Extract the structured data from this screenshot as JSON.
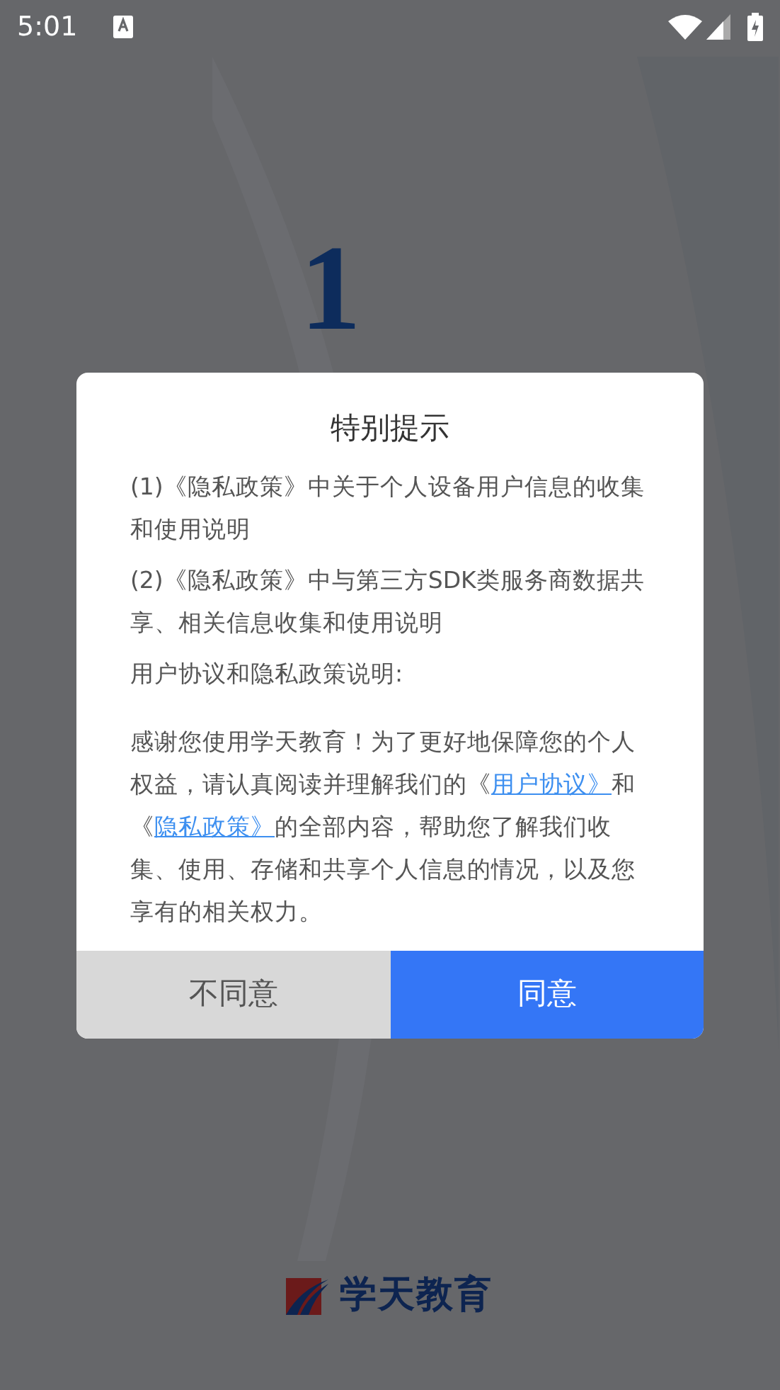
{
  "status_bar": {
    "time": "5:01"
  },
  "splash": {
    "mark": "1",
    "logo_text": "学天教育"
  },
  "dialog": {
    "title": "特别提示",
    "items": [
      "(1)《隐私政策》中关于个人设备用户信息的收集和使用说明",
      "(2)《隐私政策》中与第三方SDK类服务商数据共享、相关信息收集和使用说明",
      "用户协议和隐私政策说明:"
    ],
    "body": [
      {
        "kind": "text",
        "text": "感谢您使用学天教育！为了更好地保障您的个人权益，请认真阅读并理解我们的《"
      },
      {
        "kind": "link",
        "text": "用户协议》"
      },
      {
        "kind": "text",
        "text": "和《"
      },
      {
        "kind": "link",
        "text": "隐私政策》"
      },
      {
        "kind": "text",
        "text": "的全部内容，帮助您了解我们收集、使用、存储和共享个人信息的情况，以及您享有的相关权力。"
      }
    ],
    "buttons": [
      {
        "label": "不同意",
        "kind": "secondary"
      },
      {
        "label": "同意",
        "kind": "primary"
      }
    ]
  }
}
